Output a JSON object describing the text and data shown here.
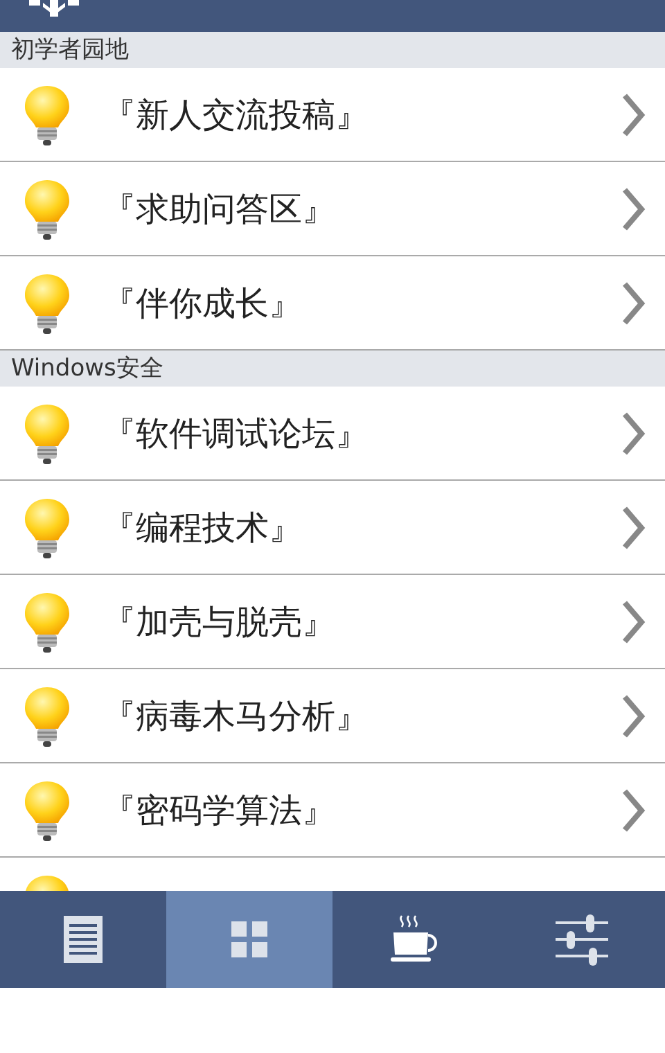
{
  "sections": [
    {
      "title": "初学者园地",
      "items": [
        {
          "label": "『新人交流投稿』"
        },
        {
          "label": "『求助问答区』"
        },
        {
          "label": "『伴你成长』"
        }
      ]
    },
    {
      "title": "Windows安全",
      "items": [
        {
          "label": "『软件调试论坛』"
        },
        {
          "label": "『编程技术』"
        },
        {
          "label": "『加壳与脱壳』"
        },
        {
          "label": "『病毒木马分析』"
        },
        {
          "label": "『密码学算法』"
        },
        {
          "kind": "partial"
        }
      ]
    }
  ],
  "tabs": [
    {
      "kind": "document",
      "selected": false
    },
    {
      "kind": "grid",
      "selected": true
    },
    {
      "kind": "coffee",
      "selected": false
    },
    {
      "kind": "sliders",
      "selected": false
    }
  ]
}
